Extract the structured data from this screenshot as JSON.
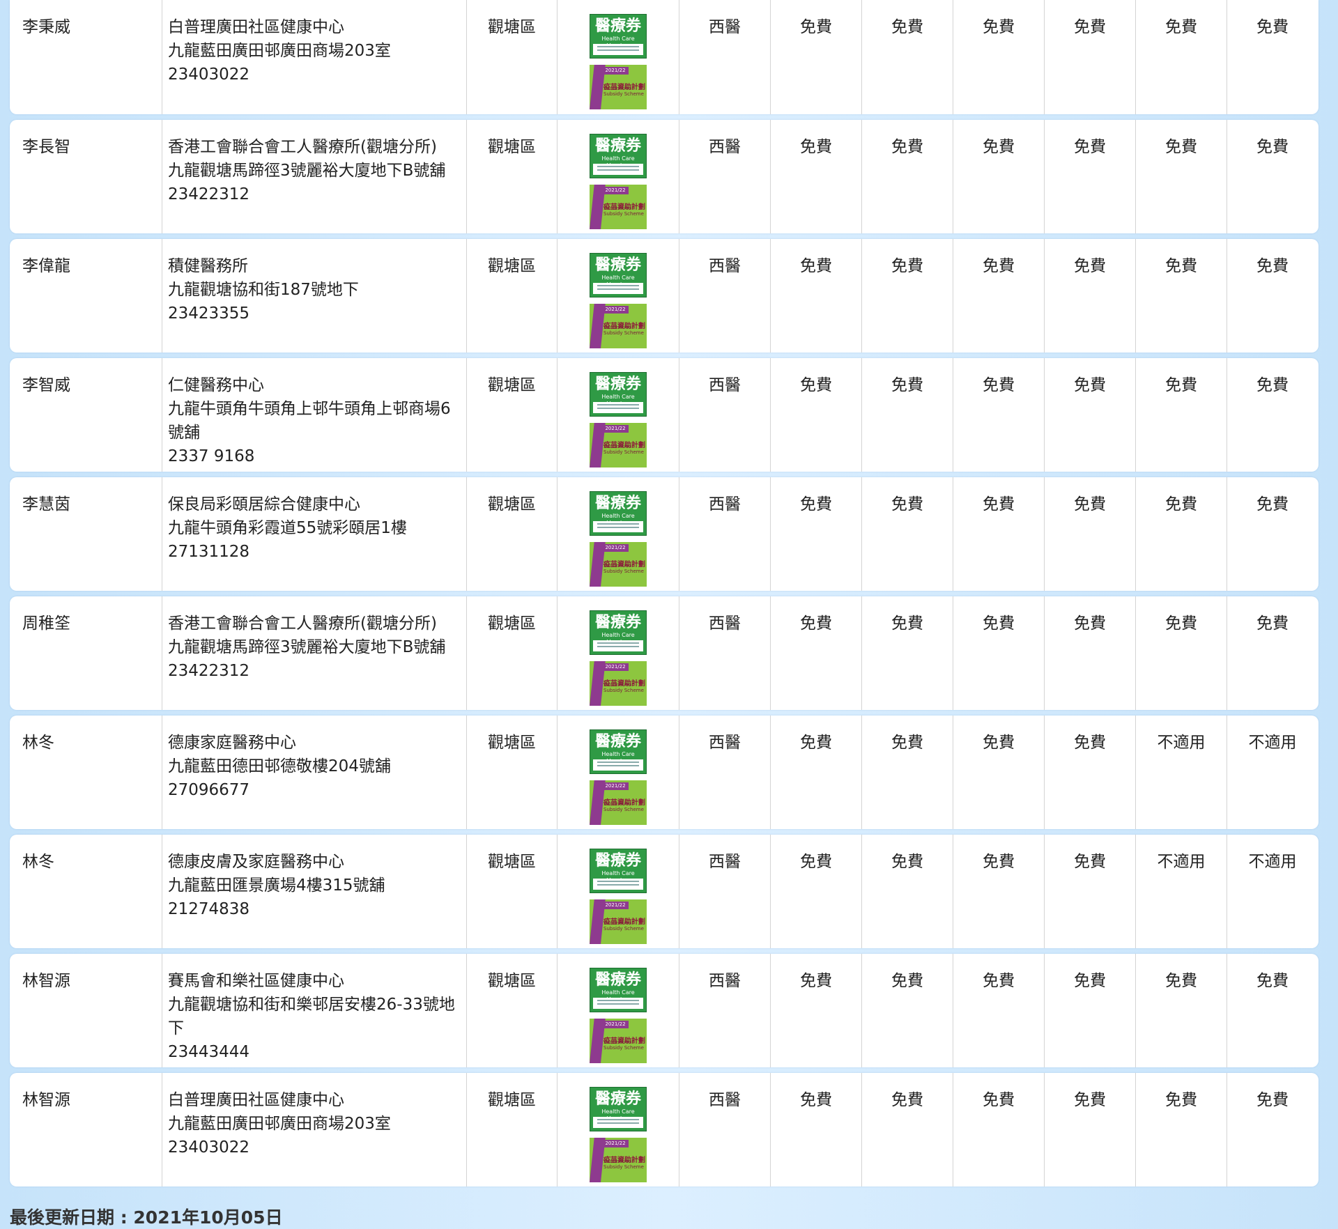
{
  "scheme": {
    "hcv_title": "醫療券",
    "hcv_subtitle": "Health Care Voucher",
    "vss_year": "2021/22",
    "vss_title": "疫苗資助計劃",
    "vss_subtitle_1": "Vaccination",
    "vss_subtitle_2": "Subsidy Scheme"
  },
  "rows": [
    {
      "name": "李秉威",
      "clinic": "白普理廣田社區健康中心",
      "address": "九龍藍田廣田邨廣田商場203室",
      "address2": "",
      "phone": "23403022",
      "district": "觀塘區",
      "type": "西醫",
      "values": [
        "免費",
        "免費",
        "免費",
        "免費",
        "免費",
        "免費"
      ]
    },
    {
      "name": "李長智",
      "clinic": "香港工會聯合會工人醫療所(觀塘分所)",
      "address": "九龍觀塘馬蹄徑3號麗裕大廈地下B號舖",
      "address2": "",
      "phone": "23422312",
      "district": "觀塘區",
      "type": "西醫",
      "values": [
        "免費",
        "免費",
        "免費",
        "免費",
        "免費",
        "免費"
      ]
    },
    {
      "name": "李偉龍",
      "clinic": "積健醫務所",
      "address": "九龍觀塘協和街187號地下",
      "address2": "",
      "phone": "23423355",
      "district": "觀塘區",
      "type": "西醫",
      "values": [
        "免費",
        "免費",
        "免費",
        "免費",
        "免費",
        "免費"
      ]
    },
    {
      "name": "李智威",
      "clinic": "仁健醫務中心",
      "address": "九龍牛頭角牛頭角上邨牛頭角上邨商場6",
      "address2": "號舖",
      "phone": "2337 9168",
      "district": "觀塘區",
      "type": "西醫",
      "values": [
        "免費",
        "免費",
        "免費",
        "免費",
        "免費",
        "免費"
      ]
    },
    {
      "name": "李慧茵",
      "clinic": "保良局彩頤居綜合健康中心",
      "address": "九龍牛頭角彩霞道55號彩頤居1樓",
      "address2": "",
      "phone": "27131128",
      "district": "觀塘區",
      "type": "西醫",
      "values": [
        "免費",
        "免費",
        "免費",
        "免費",
        "免費",
        "免費"
      ]
    },
    {
      "name": "周稚筌",
      "clinic": "香港工會聯合會工人醫療所(觀塘分所)",
      "address": "九龍觀塘馬蹄徑3號麗裕大廈地下B號舖",
      "address2": "",
      "phone": "23422312",
      "district": "觀塘區",
      "type": "西醫",
      "values": [
        "免費",
        "免費",
        "免費",
        "免費",
        "免費",
        "免費"
      ]
    },
    {
      "name": "林冬",
      "clinic": "德康家庭醫務中心",
      "address": "九龍藍田德田邨德敬樓204號舖",
      "address2": "",
      "phone": "27096677",
      "district": "觀塘區",
      "type": "西醫",
      "values": [
        "免費",
        "免費",
        "免費",
        "免費",
        "不適用",
        "不適用"
      ]
    },
    {
      "name": "林冬",
      "clinic": "德康皮膚及家庭醫務中心",
      "address": "九龍藍田匯景廣場4樓315號舖",
      "address2": "",
      "phone": "21274838",
      "district": "觀塘區",
      "type": "西醫",
      "values": [
        "免費",
        "免費",
        "免費",
        "免費",
        "不適用",
        "不適用"
      ]
    },
    {
      "name": "林智源",
      "clinic": "賽馬會和樂社區健康中心",
      "address": "九龍觀塘協和街和樂邨居安樓26-33號地",
      "address2": "下",
      "phone": "23443444",
      "district": "觀塘區",
      "type": "西醫",
      "values": [
        "免費",
        "免費",
        "免費",
        "免費",
        "免費",
        "免費"
      ]
    },
    {
      "name": "林智源",
      "clinic": "白普理廣田社區健康中心",
      "address": "九龍藍田廣田邨廣田商場203室",
      "address2": "",
      "phone": "23403022",
      "district": "觀塘區",
      "type": "西醫",
      "values": [
        "免費",
        "免費",
        "免費",
        "免費",
        "免費",
        "免費"
      ]
    }
  ],
  "footer": {
    "last_updated": "最後更新日期 : 2021年10月05日"
  }
}
